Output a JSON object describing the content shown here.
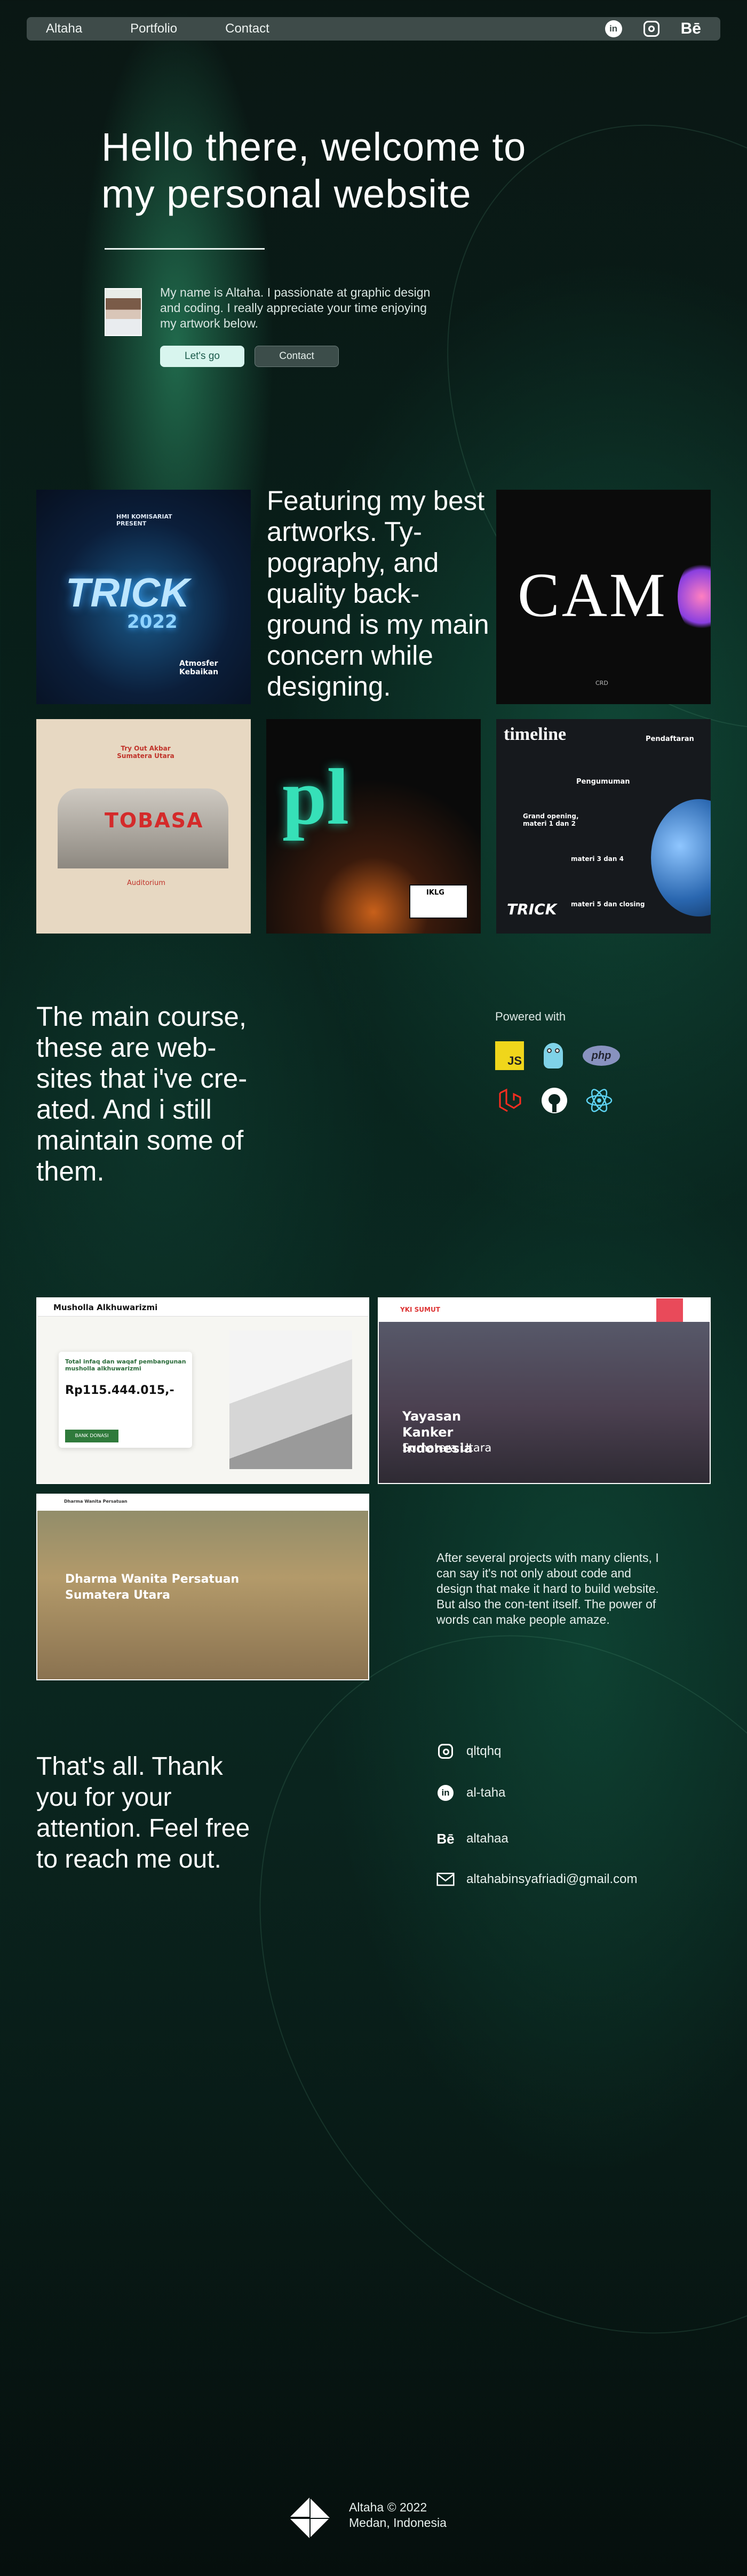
{
  "nav": {
    "items": [
      "Altaha",
      "Portfolio",
      "Contact"
    ],
    "icons": [
      "linkedin-icon",
      "instagram-icon",
      "behance-icon"
    ]
  },
  "hero": {
    "title": "Hello there, welcome to my personal website",
    "intro": "My name is Altaha. I passionate at graphic design and coding. I really appreciate your time enjoying my artwork below.",
    "btn_go": "Let's go",
    "btn_contact": "Contact"
  },
  "gallery": {
    "heading": "Featuring my best artworks. Ty-pography, and quality back-ground is my main concern while designing.",
    "artworks": [
      {
        "title": "TRICK",
        "subtitle": "2022",
        "top": "HMI KOMISARIAT PRESENT",
        "small": "Atmosfer Kebaikan"
      },
      {
        "title": "CAM",
        "small": "CRD"
      },
      {
        "title": "Try Out Akbar Sumatera Utara",
        "big": "TOBASA",
        "small": "Auditorium"
      },
      {
        "title": "pl",
        "small": "IKLG"
      },
      {
        "title": "timeline",
        "items": [
          "Pendaftaran",
          "Pengumuman",
          "Grand opening, materi 1 dan 2",
          "materi 3 dan 4",
          "materi 5 dan closing"
        ],
        "brand": "TRICK"
      }
    ]
  },
  "course": {
    "heading": "The main course, these are web-sites that i've cre-ated. And i still maintain some of them.",
    "powered_label": "Powered with",
    "tech": [
      "js-icon",
      "golang-icon",
      "php-icon",
      "laravel-icon",
      "github-icon",
      "react-icon"
    ],
    "tech_labels": {
      "js": "JS",
      "php": "php"
    }
  },
  "sites": [
    {
      "brand": "Musholla Alkhuwarizmi",
      "label": "Total infaq dan waqaf pembangunan musholla alkhuwarizmi",
      "amount": "Rp115.444.015,-",
      "cta": "BANK DONASI"
    },
    {
      "brand": "YKI SUMUT",
      "title": "Yayasan Kanker Indonesia",
      "subtitle": "Sumatera Utara"
    },
    {
      "brand": "Dharma Wanita Persatuan",
      "title": "Dharma Wanita Persatuan",
      "subtitle": "Sumatera Utara"
    }
  ],
  "sites_desc": "After several projects with many clients, I can say it's not only about code and design that make it hard to build website. But also the con-tent itself. The power of words can make people amaze.",
  "thanks": {
    "heading": "That's all. Thank you for your attention. Feel free to reach me out.",
    "contacts": [
      {
        "icon": "instagram-icon",
        "label": "qltqhq"
      },
      {
        "icon": "linkedin-icon",
        "label": "al-taha"
      },
      {
        "icon": "behance-icon",
        "label": "altahaa"
      },
      {
        "icon": "mail-icon",
        "label": "altahabinsyafriadi@gmail.com"
      }
    ]
  },
  "footer": {
    "line1": "Altaha © 2022",
    "line2": "Medan, Indonesia"
  }
}
